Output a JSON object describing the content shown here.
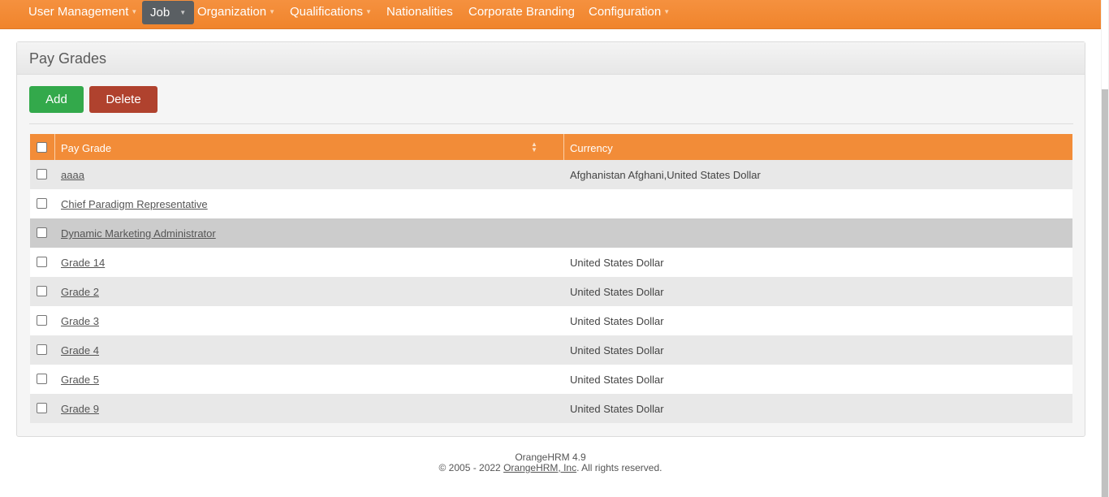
{
  "nav": {
    "items": [
      {
        "label": "User Management",
        "has_caret": true
      },
      {
        "label": "Job",
        "has_caret": true,
        "active": true
      },
      {
        "label": "Organization",
        "has_caret": true
      },
      {
        "label": "Qualifications",
        "has_caret": true
      },
      {
        "label": "Nationalities",
        "has_caret": false
      },
      {
        "label": "Corporate Branding",
        "has_caret": false
      },
      {
        "label": "Configuration",
        "has_caret": true
      }
    ],
    "caret_glyph": "▼"
  },
  "panel": {
    "title": "Pay Grades",
    "add_label": "Add",
    "delete_label": "Delete"
  },
  "table": {
    "headers": {
      "pay_grade": "Pay Grade",
      "currency": "Currency"
    },
    "rows": [
      {
        "pay_grade": "aaaa",
        "currency": "Afghanistan Afghani,United States Dollar"
      },
      {
        "pay_grade": "Chief Paradigm Representative",
        "currency": ""
      },
      {
        "pay_grade": "Dynamic Marketing Administrator",
        "currency": ""
      },
      {
        "pay_grade": "Grade 14",
        "currency": "United States Dollar"
      },
      {
        "pay_grade": "Grade 2",
        "currency": "United States Dollar"
      },
      {
        "pay_grade": "Grade 3",
        "currency": "United States Dollar"
      },
      {
        "pay_grade": "Grade 4",
        "currency": "United States Dollar"
      },
      {
        "pay_grade": "Grade 5",
        "currency": "United States Dollar"
      },
      {
        "pay_grade": "Grade 9",
        "currency": "United States Dollar"
      }
    ]
  },
  "footer": {
    "version": "OrangeHRM 4.9",
    "copyright_prefix": "© 2005 - 2022 ",
    "company_link": "OrangeHRM, Inc",
    "copyright_suffix": ". All rights reserved."
  },
  "colors": {
    "nav_bg": "#f28c38",
    "nav_active_bg": "#5a5f63",
    "add_button": "#33a94b",
    "delete_button": "#b0422e",
    "table_header": "#f28c38"
  },
  "icons": {
    "sort": "sort-arrows-icon",
    "caret": "caret-down-icon"
  }
}
